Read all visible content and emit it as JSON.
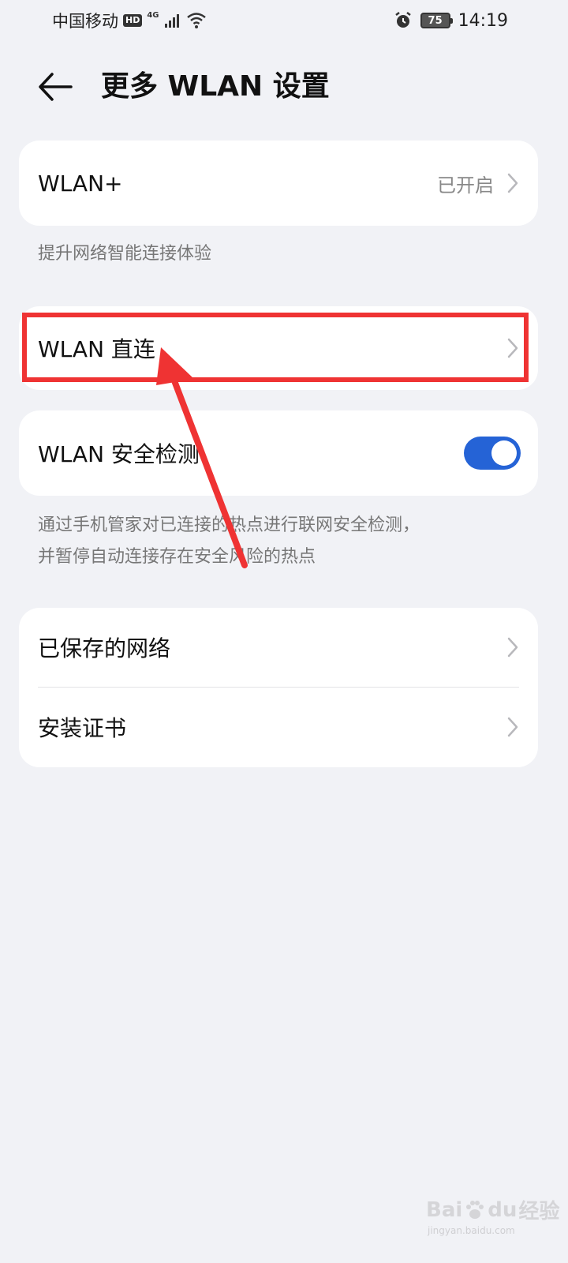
{
  "status_bar": {
    "carrier": "中国移动",
    "hd_badge": "HD",
    "network_type": "4G",
    "battery": "75",
    "time": "14:19"
  },
  "header": {
    "title": "更多 WLAN 设置",
    "back_icon": "arrow-left-icon"
  },
  "wlan_plus": {
    "label": "WLAN+",
    "value": "已开启",
    "description": "提升网络智能连接体验"
  },
  "wlan_direct": {
    "label": "WLAN 直连"
  },
  "security_check": {
    "label": "WLAN 安全检测",
    "enabled": true,
    "description_line1": "通过手机管家对已连接的热点进行联网安全检测，",
    "description_line2": "并暂停自动连接存在安全风险的热点"
  },
  "more_list": {
    "saved_networks": "已保存的网络",
    "install_cert": "安装证书"
  },
  "annotation": {
    "color": "#ef3333"
  },
  "watermark": {
    "brand": "Bai",
    "brand2": "du",
    "cn": "经验",
    "url": "jingyan.baidu.com"
  },
  "colors": {
    "accent": "#2563d6",
    "background": "#f1f2f6"
  }
}
